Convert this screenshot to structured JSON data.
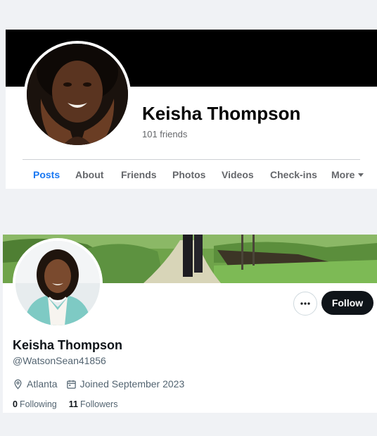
{
  "facebook": {
    "name": "Keisha Thompson",
    "friends": "101 friends",
    "tabs": [
      {
        "label": "Posts"
      },
      {
        "label": "About"
      },
      {
        "label": "Friends"
      },
      {
        "label": "Photos"
      },
      {
        "label": "Videos"
      },
      {
        "label": "Check-ins"
      },
      {
        "label": "More"
      }
    ],
    "active_tab": "Posts",
    "colors": {
      "accent": "#1877f2",
      "cover": "#000000"
    }
  },
  "twitter": {
    "name": "Keisha Thompson",
    "handle": "@WatsonSean41856",
    "location": "Atlanta",
    "joined": "Joined September 2023",
    "following_count": "0",
    "following_label": "Following",
    "followers_count": "11",
    "followers_label": "Followers",
    "follow_label": "Follow",
    "more_icon": "more-horizontal-icon",
    "colors": {
      "follow_button": "#0f1419",
      "secondary_text": "#536471"
    }
  }
}
